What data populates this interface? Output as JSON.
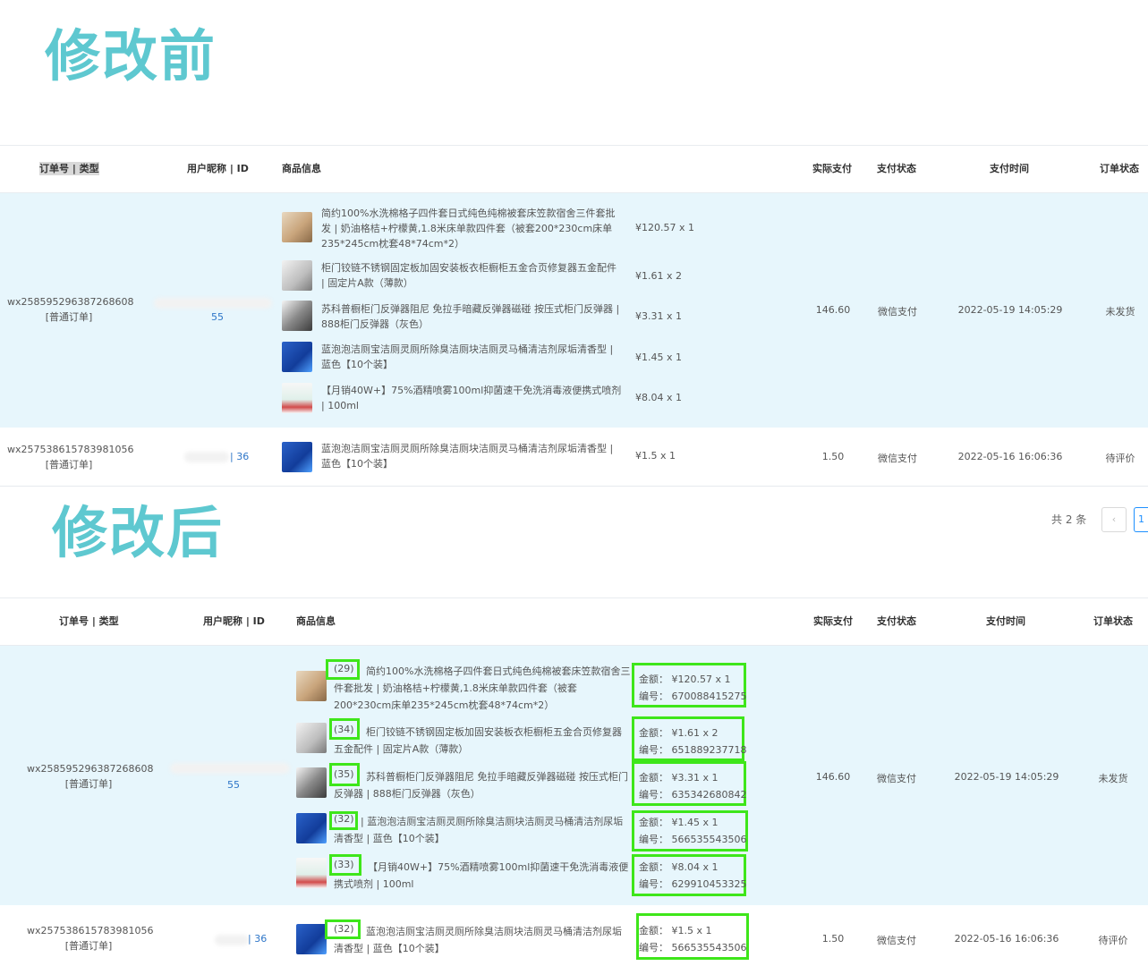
{
  "before_title": "修改前",
  "after_title": "修改后",
  "columns": [
    "订单号 | 类型",
    "用户昵称 | ID",
    "商品信息",
    "实际支付",
    "支付状态",
    "支付时间",
    "订单状态"
  ],
  "before": {
    "order1": {
      "order_no": "wx258595296387268608",
      "type": "[普通订单]",
      "uid": "55",
      "pay": "146.60",
      "pay_status": "微信支付",
      "pay_time": "2022-05-19 14:05:29",
      "order_status": "未发货",
      "items": [
        {
          "name": "简约100%水洗棉格子四件套日式纯色纯棉被套床笠款宿舍三件套批发 | 奶油格桔+柠檬黄,1.8米床单款四件套（被套200*230cm床单235*245cm枕套48*74cm*2）",
          "price": "¥120.57 x 1"
        },
        {
          "name": "柜门铰链不锈钢固定板加固安装板衣柜橱柜五金合页修复器五金配件 | 固定片A款（薄款）",
          "price": "¥1.61 x 2"
        },
        {
          "name": "苏科普橱柜门反弹器阻尼 免拉手暗藏反弹器磁碰 按压式柜门反弹器 | 888柜门反弹器（灰色）",
          "price": "¥3.31 x 1"
        },
        {
          "name": "蓝泡泡洁厕宝洁厕灵厕所除臭洁厕块洁厕灵马桶清洁剂尿垢清香型 | 蓝色【10个装】",
          "price": "¥1.45 x 1"
        },
        {
          "name": "【月销40W+】75%酒精喷雾100ml抑菌速干免洗消毒液便携式喷剂 | 100ml",
          "price": "¥8.04 x 1"
        }
      ]
    },
    "order2": {
      "order_no": "wx257538615783981056",
      "type": "[普通订单]",
      "uid": "| 36",
      "pay": "1.50",
      "pay_status": "微信支付",
      "pay_time": "2022-05-16 16:06:36",
      "order_status": "待评价",
      "items": [
        {
          "name": "蓝泡泡洁厕宝洁厕灵厕所除臭洁厕块洁厕灵马桶清洁剂尿垢清香型 | 蓝色【10个装】",
          "price": "¥1.5 x 1"
        }
      ]
    },
    "total": "共 2 条",
    "page": "1"
  },
  "after": {
    "order1": {
      "order_no": "wx258595296387268608",
      "type": "[普通订单]",
      "uid": "55",
      "pay": "146.60",
      "pay_status": "微信支付",
      "pay_time": "2022-05-19 14:05:29",
      "order_status": "未发货",
      "items": [
        {
          "count": "(29)",
          "name": "简约100%水洗棉格子四件套日式纯色纯棉被套床笠款宿舍三件套批发 | 奶油格桔+柠檬黄,1.8米床单款四件套（被套200*230cm床单235*245cm枕套48*74cm*2）",
          "amount": "金额：  ¥120.57 x 1",
          "code": "编号：  670088415275"
        },
        {
          "count": "(34)",
          "name": "柜门铰链不锈钢固定板加固安装板衣柜橱柜五金合页修复器五金配件 | 固定片A款（薄款）",
          "amount": "金额：  ¥1.61 x 2",
          "code": "编号：  651889237718"
        },
        {
          "count": "(35)",
          "name": "苏科普橱柜门反弹器阻尼 免拉手暗藏反弹器磁碰 按压式柜门反弹器 | 888柜门反弹器（灰色）",
          "amount": "金额：  ¥3.31 x 1",
          "code": "编号：  635342680842"
        },
        {
          "count": "(32)",
          "name": "| 蓝泡泡洁厕宝洁厕灵厕所除臭洁厕块洁厕灵马桶清洁剂尿垢清香型 | 蓝色【10个装】",
          "amount": "金额：  ¥1.45 x 1",
          "code": "编号：  566535543506"
        },
        {
          "count": "(33)",
          "name": "【月销40W+】75%酒精喷雾100ml抑菌速干免洗消毒液便携式喷剂 | 100ml",
          "amount": "金额：  ¥8.04 x 1",
          "code": "编号：  629910453325"
        }
      ]
    },
    "order2": {
      "order_no": "wx257538615783981056",
      "type": "[普通订单]",
      "uid": "| 36",
      "pay": "1.50",
      "pay_status": "微信支付",
      "pay_time": "2022-05-16 16:06:36",
      "order_status": "待评价",
      "items": [
        {
          "count": "(32)",
          "name": "蓝泡泡洁厕宝洁厕灵厕所除臭洁厕块洁厕灵马桶清洁剂尿垢清香型 | 蓝色【10个装】",
          "amount": "金额：  ¥1.5 x 1",
          "code": "编号：  566535543506"
        }
      ]
    }
  }
}
